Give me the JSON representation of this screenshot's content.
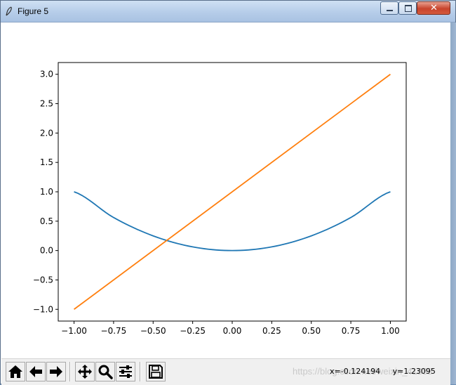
{
  "window": {
    "title": "Figure 5",
    "icons": {
      "app": "feather-icon",
      "minimize": "minimize-icon",
      "maximize": "maximize-icon",
      "close": "close-icon"
    },
    "close_glyph": "✕"
  },
  "toolbar": {
    "buttons": [
      {
        "name": "home-button",
        "icon": "home-icon"
      },
      {
        "name": "back-button",
        "icon": "arrow-left-icon"
      },
      {
        "name": "forward-button",
        "icon": "arrow-right-icon"
      },
      {
        "name": "pan-button",
        "icon": "move-icon"
      },
      {
        "name": "zoom-button",
        "icon": "magnifier-icon"
      },
      {
        "name": "configure-subplots-button",
        "icon": "sliders-icon"
      },
      {
        "name": "save-button",
        "icon": "floppy-disk-icon"
      }
    ],
    "coordinates": "x=-0.124194     y=1.23095",
    "watermark": "https://blog.csdn.net/weixin_41888"
  },
  "chart_data": {
    "type": "line",
    "xlim": [
      -1.1,
      1.1
    ],
    "ylim": [
      -1.2,
      3.2
    ],
    "x_ticks": [
      -1.0,
      -0.75,
      -0.5,
      -0.25,
      0.0,
      0.25,
      0.5,
      0.75,
      1.0
    ],
    "x_tick_labels": [
      "−1.00",
      "−0.75",
      "−0.50",
      "−0.25",
      "0.00",
      "0.25",
      "0.50",
      "0.75",
      "1.00"
    ],
    "y_ticks": [
      -1.0,
      -0.5,
      0.0,
      0.5,
      1.0,
      1.5,
      2.0,
      2.5,
      3.0
    ],
    "y_tick_labels": [
      "−1.0",
      "−0.5",
      "0.0",
      "0.5",
      "1.0",
      "1.5",
      "2.0",
      "2.5",
      "3.0"
    ],
    "grid": false,
    "series": [
      {
        "color": "#1f77b4",
        "x": [
          -1.0,
          -0.75,
          -0.5,
          -0.25,
          0.0,
          0.25,
          0.5,
          0.75,
          1.0
        ],
        "y": [
          1.0,
          0.5625,
          0.25,
          0.0625,
          0.0,
          0.0625,
          0.25,
          0.5625,
          1.0
        ]
      },
      {
        "color": "#ff7f0e",
        "x": [
          -1.0,
          1.0
        ],
        "y": [
          -1.0,
          3.0
        ]
      }
    ]
  }
}
